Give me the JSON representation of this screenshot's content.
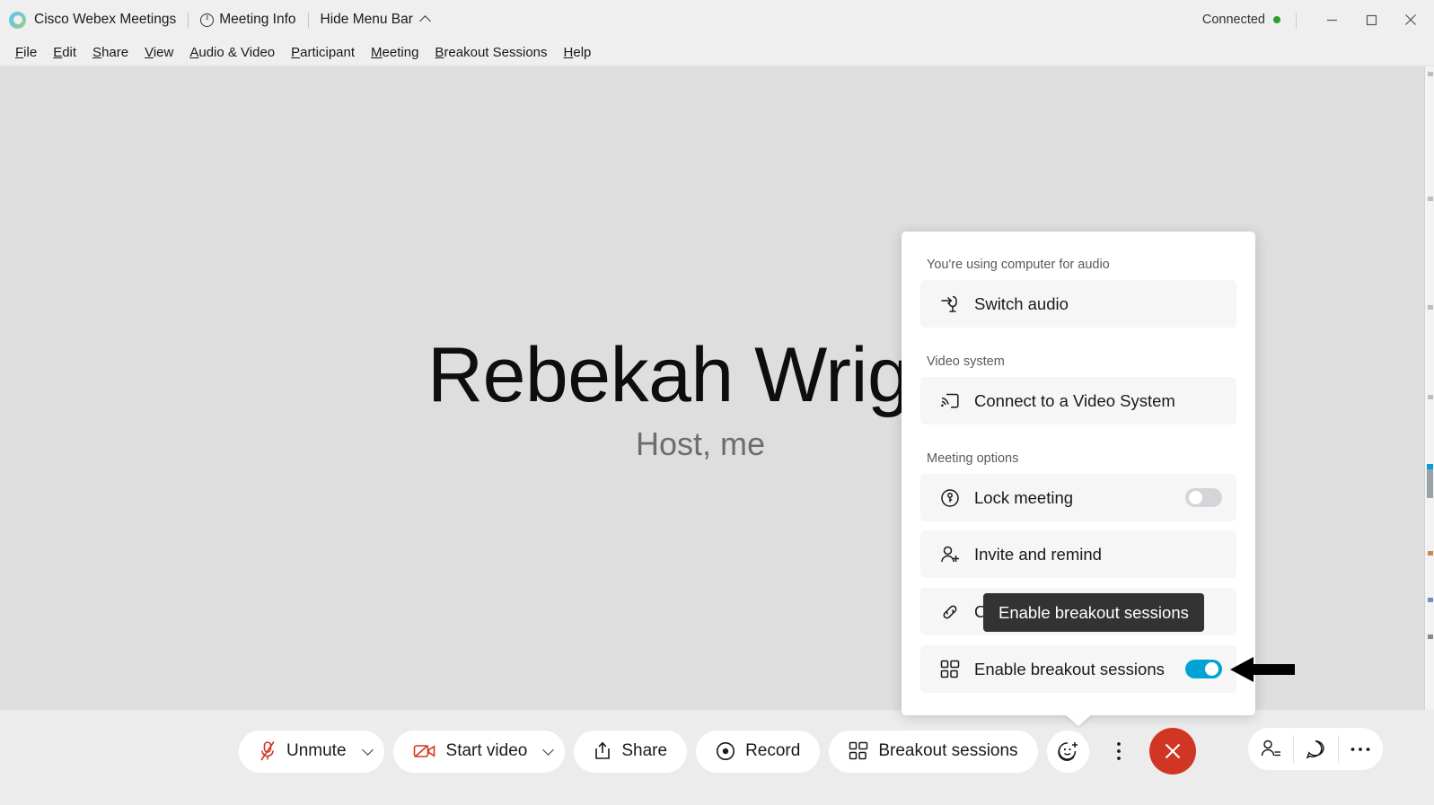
{
  "window": {
    "app_title": "Cisco Webex Meetings",
    "meeting_info_label": "Meeting Info",
    "hide_menu_bar_label": "Hide Menu Bar",
    "connection_status": "Connected",
    "status_color": "#2aa02a",
    "minimize_label": "Minimize",
    "maximize_label": "Maximize",
    "close_label": "Close"
  },
  "menubar": {
    "items": [
      {
        "label": "File",
        "accel": "F"
      },
      {
        "label": "Edit",
        "accel": "E"
      },
      {
        "label": "Share",
        "accel": "S"
      },
      {
        "label": "View",
        "accel": "V"
      },
      {
        "label": "Audio & Video",
        "accel": "A"
      },
      {
        "label": "Participant",
        "accel": "P"
      },
      {
        "label": "Meeting",
        "accel": "M"
      },
      {
        "label": "Breakout Sessions",
        "accel": "B"
      },
      {
        "label": "Help",
        "accel": "H"
      }
    ]
  },
  "stage": {
    "participant_name": "Rebekah Wright",
    "participant_role": "Host, me",
    "background_color": "#dedede"
  },
  "panel": {
    "sections": [
      {
        "label": "You're using computer for audio",
        "rows": [
          {
            "label": "Switch audio",
            "icon": "switch-audio-icon",
            "toggle": null
          }
        ]
      },
      {
        "label": "Video system",
        "rows": [
          {
            "label": "Connect to a Video System",
            "icon": "cast-screen-icon",
            "toggle": null
          }
        ]
      },
      {
        "label": "Meeting options",
        "rows": [
          {
            "label": "Lock meeting",
            "icon": "lock-meeting-icon",
            "toggle": "off"
          },
          {
            "label": "Invite and remind",
            "icon": "invite-person-icon",
            "toggle": null
          },
          {
            "label": "Copy meeting link",
            "icon": "link-chain-icon",
            "toggle": null
          },
          {
            "label": "Enable breakout sessions",
            "icon": "breakout-grid-icon",
            "toggle": "on"
          }
        ]
      }
    ],
    "toggle_on_color": "#00a3d3",
    "toggle_off_color": "#d3d5d8"
  },
  "tooltip": {
    "text": "Enable breakout sessions",
    "background_color": "#333333"
  },
  "toolbar": {
    "mute_label": "Unmute",
    "video_label": "Start video",
    "share_label": "Share",
    "record_label": "Record",
    "breakout_label": "Breakout sessions",
    "reactions_label": "Reactions",
    "more_options_label": "More options",
    "leave_label": "Leave meeting",
    "participants_label": "Participants",
    "chat_label": "Chat",
    "more_panels_label": "More panel options",
    "danger_color": "#d03623",
    "mic_off_color": "#d03623"
  },
  "annotation": {
    "arrow_label": "pointer-arrow",
    "arrow_color": "#000000"
  }
}
